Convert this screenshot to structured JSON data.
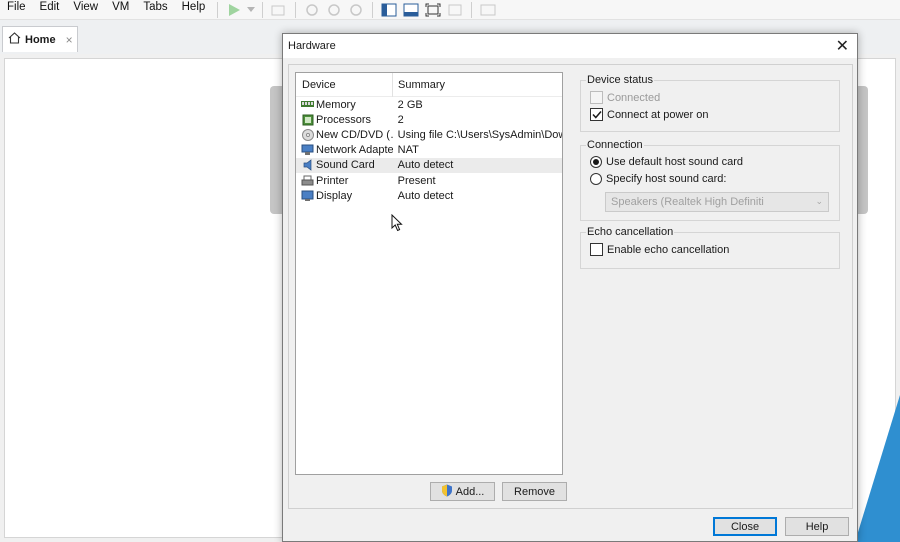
{
  "menu": [
    "File",
    "Edit",
    "View",
    "VM",
    "Tabs",
    "Help"
  ],
  "tabs": {
    "home_label": "Home",
    "close_glyph": "×"
  },
  "dialog": {
    "title": "Hardware",
    "close_glyph": "✕",
    "columns": {
      "device": "Device",
      "summary": "Summary"
    },
    "devices": [
      {
        "name": "Memory",
        "summary": "2 GB",
        "icon": "memory-icon"
      },
      {
        "name": "Processors",
        "summary": "2",
        "icon": "processor-icon"
      },
      {
        "name": "New CD/DVD (…",
        "summary": "Using file C:\\Users\\SysAdmin\\Dow…",
        "icon": "cd-dvd-icon"
      },
      {
        "name": "Network Adapter",
        "summary": "NAT",
        "icon": "network-adapter-icon"
      },
      {
        "name": "Sound Card",
        "summary": "Auto detect",
        "icon": "sound-card-icon",
        "selected": true
      },
      {
        "name": "Printer",
        "summary": "Present",
        "icon": "printer-icon"
      },
      {
        "name": "Display",
        "summary": "Auto detect",
        "icon": "display-icon"
      }
    ],
    "add_label": "Add...",
    "remove_label": "Remove",
    "device_status": {
      "title": "Device status",
      "connected_label": "Connected",
      "connected_checked": false,
      "connected_enabled": false,
      "connect_power_label": "Connect at power on",
      "connect_power_checked": true
    },
    "connection": {
      "title": "Connection",
      "default_label": "Use default host sound card",
      "specify_label": "Specify host sound card:",
      "selected": "default",
      "dropdown_value": "Speakers (Realtek High Definiti"
    },
    "echo": {
      "title": "Echo cancellation",
      "enable_label": "Enable echo cancellation",
      "enable_checked": false
    },
    "close_label": "Close",
    "help_label": "Help"
  },
  "colors": {
    "accent": "#0078d7",
    "selection": "#ebebeb",
    "brand_blue": "#2f8fd0"
  }
}
